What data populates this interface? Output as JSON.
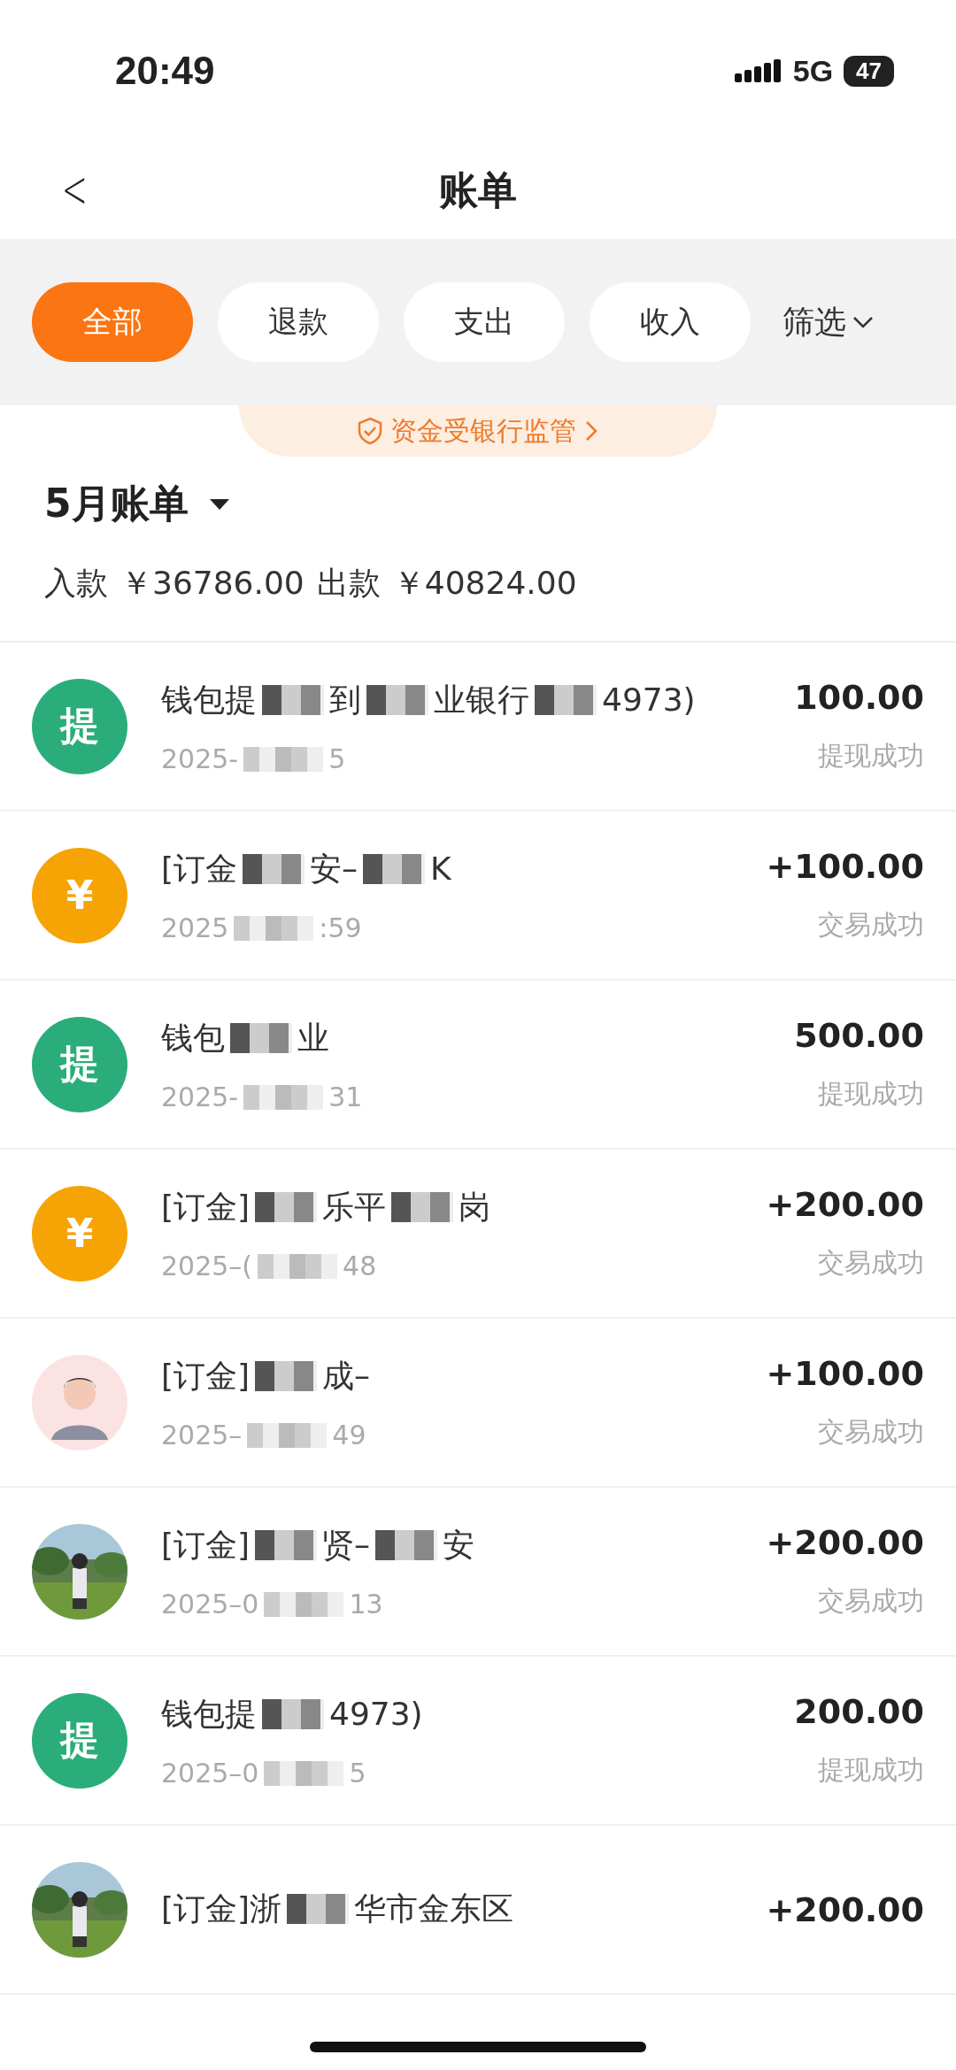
{
  "status_bar": {
    "time": "20:49",
    "network": "5G",
    "battery": "47"
  },
  "header": {
    "back": "<",
    "title": "账单"
  },
  "filters": [
    {
      "label": "全部",
      "selected": true
    },
    {
      "label": "退款",
      "selected": false
    },
    {
      "label": "支出",
      "selected": false
    },
    {
      "label": "收入",
      "selected": false
    }
  ],
  "filter_menu": {
    "label": "筛选"
  },
  "notice": {
    "text": "资金受银行监管"
  },
  "month": {
    "title": "5月账单",
    "income_label": "入款",
    "income": "￥36786.00",
    "expense_label": "出款",
    "expense": "￥40824.00"
  },
  "records": [
    {
      "avatar": {
        "kind": "badge",
        "text": "提",
        "color": "#2bad7b"
      },
      "title_parts": [
        "钱包提",
        "到",
        "业银行",
        "4973)"
      ],
      "date_parts": [
        "2025-",
        "5"
      ],
      "amount": "100.00",
      "status": "提现成功"
    },
    {
      "avatar": {
        "kind": "badge",
        "text": "¥",
        "color": "#f6a306"
      },
      "title_parts": [
        "[订金",
        "安–",
        "K"
      ],
      "date_parts": [
        "2025",
        ":59"
      ],
      "amount": "+100.00",
      "status": "交易成功"
    },
    {
      "avatar": {
        "kind": "badge",
        "text": "提",
        "color": "#2bad7b"
      },
      "title_parts": [
        "钱包",
        "业"
      ],
      "date_parts": [
        "2025-",
        "31"
      ],
      "amount": "500.00",
      "status": "提现成功"
    },
    {
      "avatar": {
        "kind": "badge",
        "text": "¥",
        "color": "#f6a306"
      },
      "title_parts": [
        "[订金]",
        "乐平",
        "岗"
      ],
      "date_parts": [
        "2025–(",
        "48"
      ],
      "amount": "+200.00",
      "status": "交易成功"
    },
    {
      "avatar": {
        "kind": "person"
      },
      "title_parts": [
        "[订金]",
        "成–"
      ],
      "date_parts": [
        "2025–",
        "49"
      ],
      "amount": "+100.00",
      "status": "交易成功"
    },
    {
      "avatar": {
        "kind": "picture"
      },
      "title_parts": [
        "[订金]",
        "贤–",
        "安"
      ],
      "date_parts": [
        "2025–0",
        "13"
      ],
      "amount": "+200.00",
      "status": "交易成功"
    },
    {
      "avatar": {
        "kind": "badge",
        "text": "提",
        "color": "#2bad7b"
      },
      "title_parts": [
        "钱包提",
        "4973)"
      ],
      "date_parts": [
        "2025–0",
        "5"
      ],
      "amount": "200.00",
      "status": "提现成功"
    },
    {
      "avatar": {
        "kind": "picture"
      },
      "title_parts": [
        "[订金]浙",
        "华市金东区"
      ],
      "amount": "+200.00"
    }
  ]
}
